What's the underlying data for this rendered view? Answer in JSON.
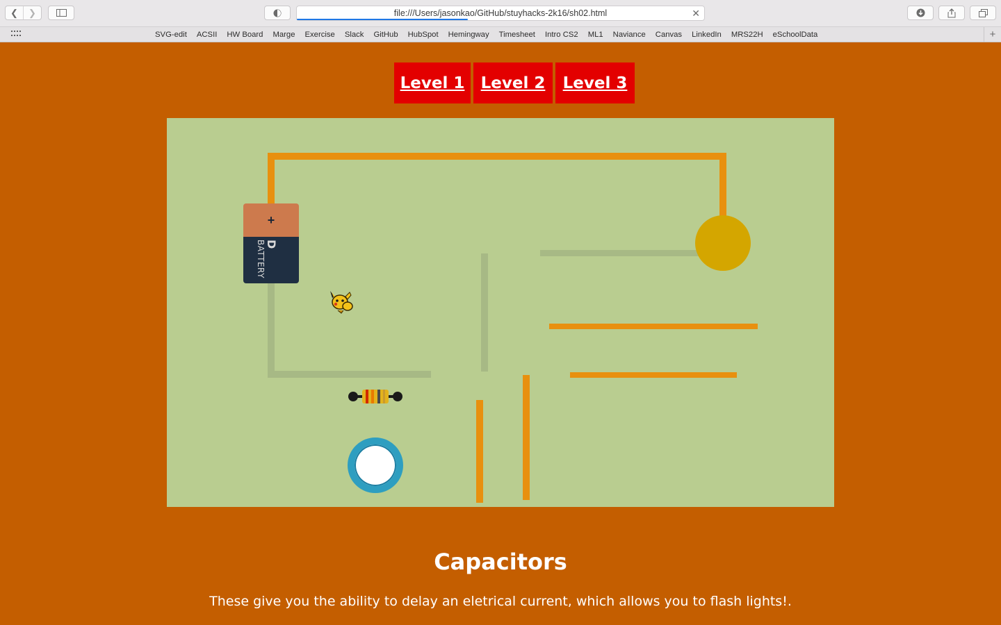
{
  "browser": {
    "url": "file:///Users/jasonkao/GitHub/stuyhacks-2k16/sh02.html",
    "load_progress": 0.42,
    "bookmarks": [
      "SVG-edit",
      "ACSII",
      "HW Board",
      "Marge",
      "Exercise",
      "Slack",
      "GitHub",
      "HubSpot",
      "Hemingway",
      "Timesheet",
      "Intro CS2",
      "ML1",
      "Naviance",
      "Canvas",
      "LinkedIn",
      "MRS22H",
      "eSchoolData"
    ]
  },
  "levels": [
    "Level 1",
    "Level 2",
    "Level 3"
  ],
  "battery": {
    "terminal": "+",
    "size": "D",
    "label": "BATTERY"
  },
  "content": {
    "title": "Capacitors",
    "description": "These give you the ability to delay an eletrical current, which allows you to flash lights!."
  },
  "colors": {
    "page_background": "#c45e00",
    "board_background": "#b9cd90",
    "active_wire": "#e8900f",
    "inactive_wire": "#a7b985",
    "level_button": "#e30000",
    "bulb": "#d4a600",
    "capacitor_ring": "#2e9ec0"
  }
}
